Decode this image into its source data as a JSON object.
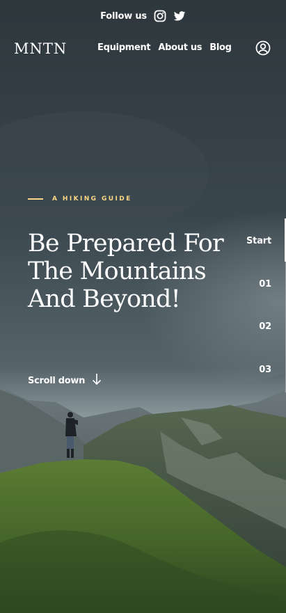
{
  "social": {
    "label": "Follow us",
    "icons": [
      "instagram-icon",
      "twitter-icon"
    ]
  },
  "header": {
    "logo": "MNTN",
    "nav": [
      "Equipment",
      "About us",
      "Blog"
    ],
    "account_icon": "user-circle-icon"
  },
  "hero": {
    "tagline": "A HIKING GUIDE",
    "title": "Be Prepared For The Mountains And Beyond!",
    "scroll_label": "Scroll down",
    "scroll_icon": "arrow-down-icon"
  },
  "pager": {
    "items": [
      "Start",
      "01",
      "02",
      "03"
    ],
    "active": "Start"
  },
  "colors": {
    "accent": "#fbd784",
    "text": "#ffffff",
    "sky": "#33404a",
    "grass": "#4e7030"
  }
}
